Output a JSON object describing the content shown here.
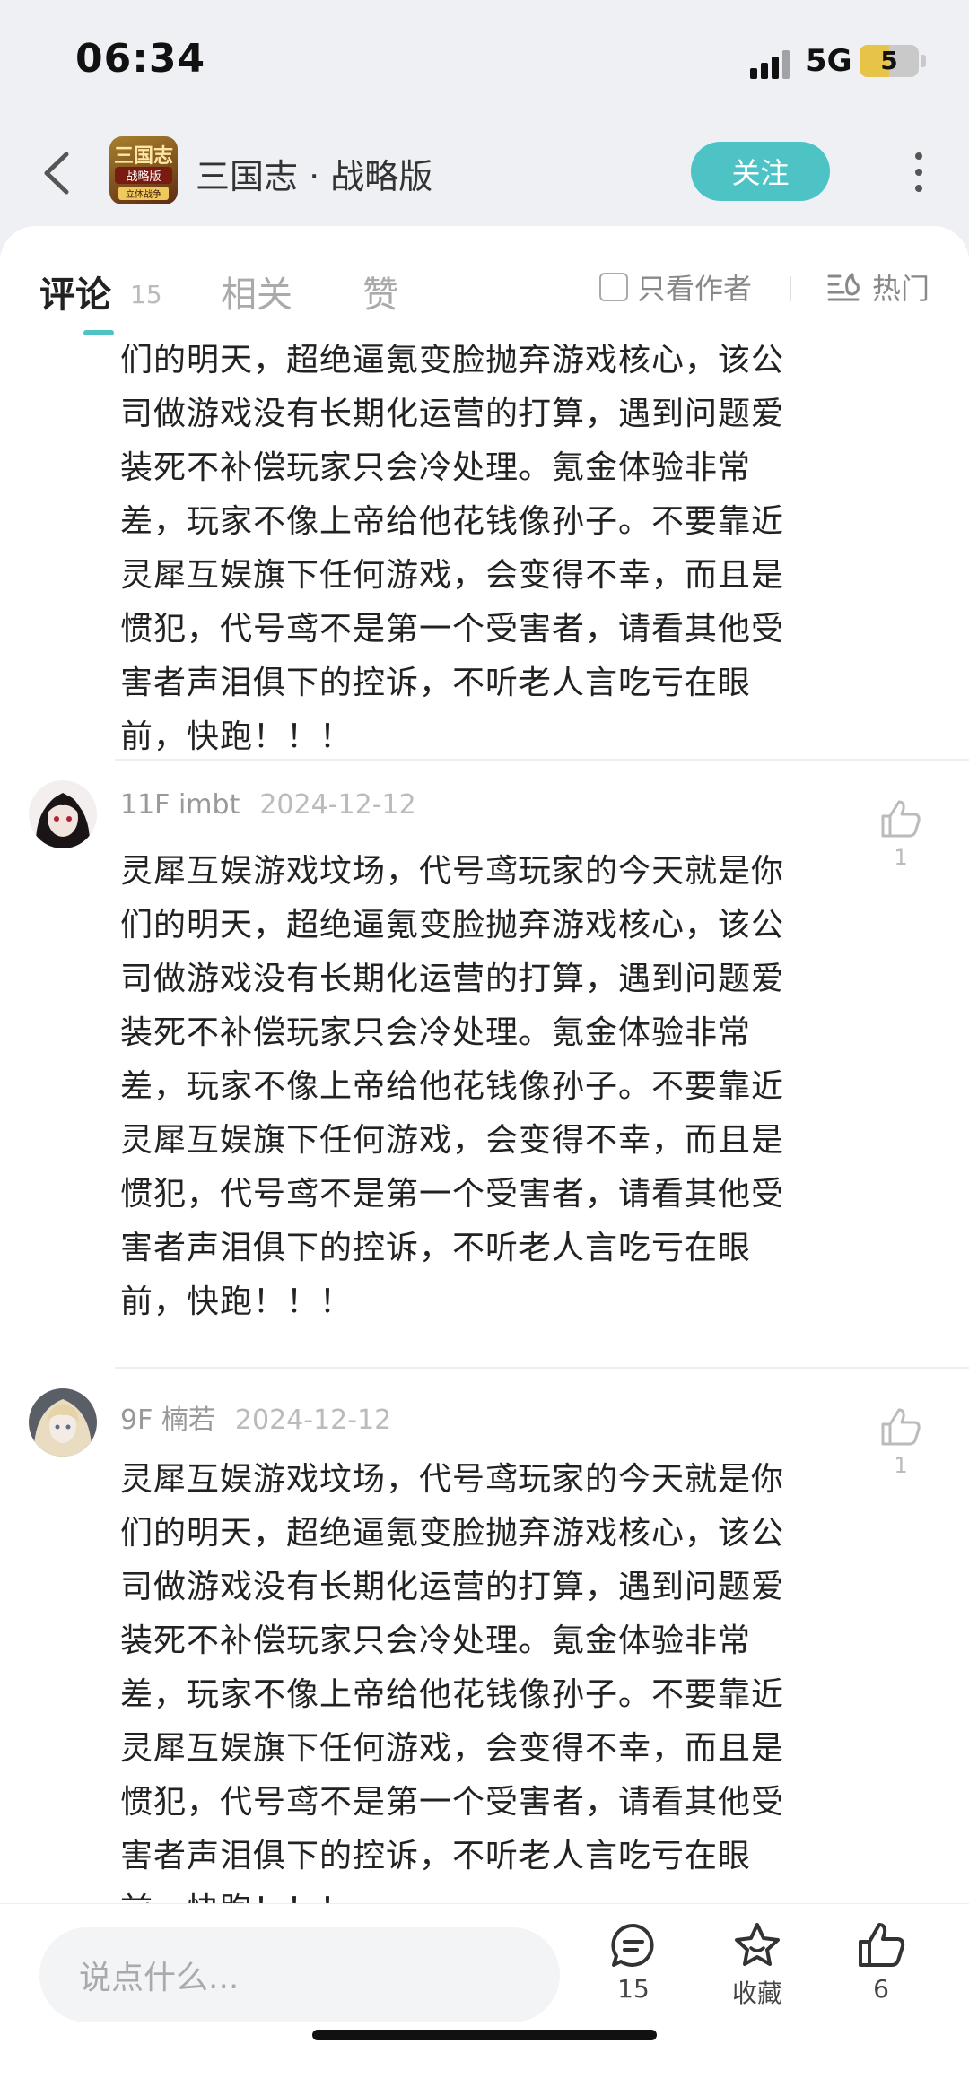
{
  "status": {
    "time": "06:34",
    "network": "5G",
    "battery": "5",
    "battery_level": 0.5
  },
  "header": {
    "app_icon_line1": "三国志",
    "app_icon_line2": "战略版",
    "app_icon_line3": "立体战争",
    "title": "三国志 · 战略版",
    "follow_label": "关注"
  },
  "tabs": {
    "items": [
      {
        "label": "评论"
      },
      {
        "label": "相关"
      },
      {
        "label": "赞"
      }
    ],
    "comment_count": "15",
    "author_only_label": "只看作者",
    "sort_label": "热门"
  },
  "previous_comment_tail": [
    "们的明天，超绝逼氪变脸抛弃游戏核心，该公",
    "司做游戏没有长期化运营的打算，遇到问题爱",
    "装死不补偿玩家只会冷处理。氪金体验非常",
    "差，玩家不像上帝给他花钱像孙子。不要靠近",
    "灵犀互娱旗下任何游戏，会变得不幸，而且是",
    "惯犯，代号鸢不是第一个受害者，请看其他受",
    "害者声泪俱下的控诉，不听老人言吃亏在眼",
    "前，快跑！！！"
  ],
  "comments": [
    {
      "floor_user": "11F imbt",
      "date": "2024-12-12",
      "likes": "1",
      "lines": [
        "灵犀互娱游戏坟场，代号鸢玩家的今天就是你",
        "们的明天，超绝逼氪变脸抛弃游戏核心，该公",
        "司做游戏没有长期化运营的打算，遇到问题爱",
        "装死不补偿玩家只会冷处理。氪金体验非常",
        "差，玩家不像上帝给他花钱像孙子。不要靠近",
        "灵犀互娱旗下任何游戏，会变得不幸，而且是",
        "惯犯，代号鸢不是第一个受害者，请看其他受",
        "害者声泪俱下的控诉，不听老人言吃亏在眼",
        "前，快跑！！！"
      ]
    },
    {
      "floor_user": "9F 楠若",
      "date": "2024-12-12",
      "likes": "1",
      "lines": [
        "灵犀互娱游戏坟场，代号鸢玩家的今天就是你",
        "们的明天，超绝逼氪变脸抛弃游戏核心，该公",
        "司做游戏没有长期化运营的打算，遇到问题爱",
        "装死不补偿玩家只会冷处理。氪金体验非常",
        "差，玩家不像上帝给他花钱像孙子。不要靠近",
        "灵犀互娱旗下任何游戏，会变得不幸，而且是",
        "惯犯，代号鸢不是第一个受害者，请看其他受",
        "害者声泪俱下的控诉，不听老人言吃亏在眼",
        "前，快跑！！！"
      ]
    }
  ],
  "bottom": {
    "input_placeholder": "说点什么...",
    "comment_count": "15",
    "favorite_label": "收藏",
    "like_count": "6"
  },
  "colors": {
    "accent": "#4dc3c6",
    "background": "#eef0f4"
  }
}
